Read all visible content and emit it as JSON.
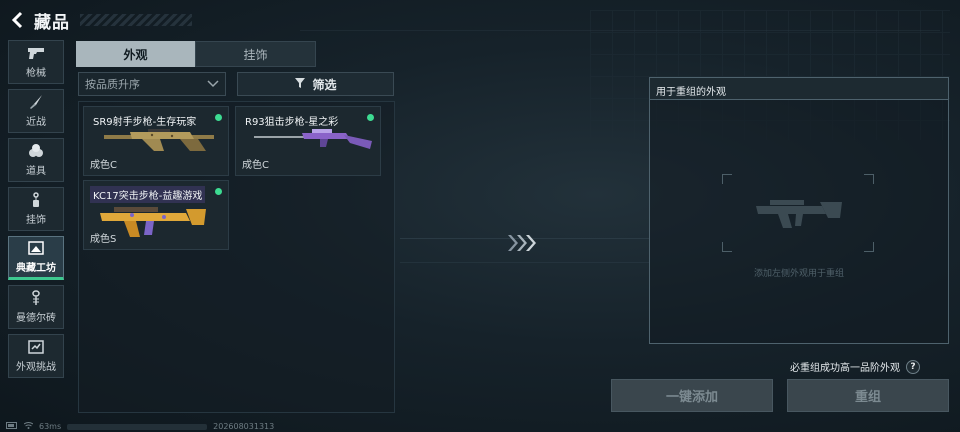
{
  "header": {
    "title": "藏品"
  },
  "sidebar": {
    "items": [
      {
        "label": "枪械",
        "icon": "pistol-icon"
      },
      {
        "label": "近战",
        "icon": "knife-icon"
      },
      {
        "label": "道具",
        "icon": "grenade-icon"
      },
      {
        "label": "挂饰",
        "icon": "charm-icon"
      },
      {
        "label": "典藏工坊",
        "icon": "workshop-icon",
        "active": true
      },
      {
        "label": "曼德尔砖",
        "icon": "mandel-brick-icon"
      },
      {
        "label": "外观挑战",
        "icon": "challenge-icon"
      }
    ]
  },
  "tabs": [
    {
      "label": "外观",
      "active": true
    },
    {
      "label": "挂饰",
      "active": false
    }
  ],
  "sort": {
    "selected": "按品质升序"
  },
  "filter": {
    "label": "筛选"
  },
  "items": [
    {
      "name": "SR9射手步枪-生存玩家",
      "grade": "成色C",
      "new_indicator": true,
      "accent": "#b89a58"
    },
    {
      "name": "R93狙击步枪-星之彩",
      "grade": "成色C",
      "new_indicator": true,
      "accent": "#8a63c9"
    },
    {
      "name": "KC17突击步枪-益趣游戏",
      "grade": "成色S",
      "new_indicator": true,
      "accent": "#e0a83a"
    }
  ],
  "recombine": {
    "header": "用于重组的外观",
    "placeholder_hint": "添加左侧外观用于重组"
  },
  "hint": {
    "text": "必重组成功高一品阶外观",
    "help": "?"
  },
  "buttons": {
    "quick_add": "一键添加",
    "recombine": "重组"
  },
  "status": {
    "ping": "63ms",
    "build": "202608031313"
  },
  "colors": {
    "accent_green": "#3ddc92",
    "active_tab": "#a9b6bc",
    "button_disabled": "#3a464d"
  }
}
